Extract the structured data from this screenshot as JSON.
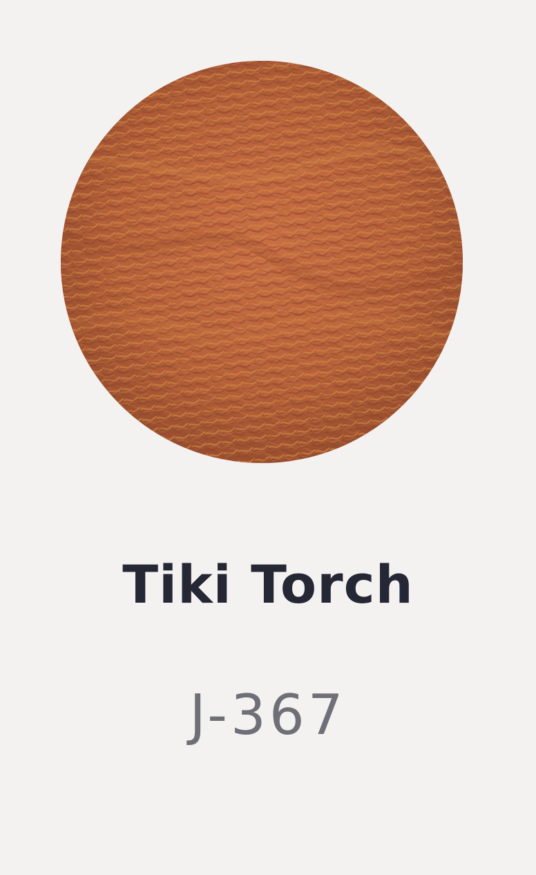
{
  "product": {
    "name": "Tiki Torch",
    "code": "J-367"
  },
  "swatch": {
    "icon": "thread-spool-swatch",
    "base_color": "#b6603a",
    "highlight_color": "#d38a44",
    "shadow_color": "#8b4529"
  },
  "theme": {
    "background": "#f4f2f1",
    "title_color": "#252735",
    "code_color": "#6f7077"
  }
}
